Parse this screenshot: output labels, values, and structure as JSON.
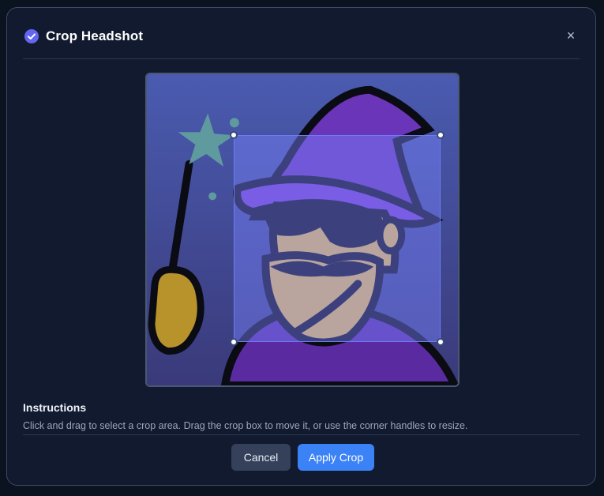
{
  "dialog": {
    "title": "Crop Headshot",
    "title_icon": "check-circle-icon",
    "close_label": "×",
    "close_icon": "close-icon"
  },
  "image": {
    "subject": "wizard-avatar",
    "crop_box": {
      "handles": [
        "top-left",
        "top-right",
        "bottom-left",
        "bottom-right"
      ]
    }
  },
  "instructions": {
    "heading": "Instructions",
    "text": "Click and drag to select a crop area. Drag the crop box to move it, or use the corner handles to resize."
  },
  "footer": {
    "cancel_label": "Cancel",
    "apply_label": "Apply Crop"
  },
  "colors": {
    "accent": "#3b82f6",
    "crop_overlay": "#7882ff",
    "title_icon": "#6366f1"
  }
}
